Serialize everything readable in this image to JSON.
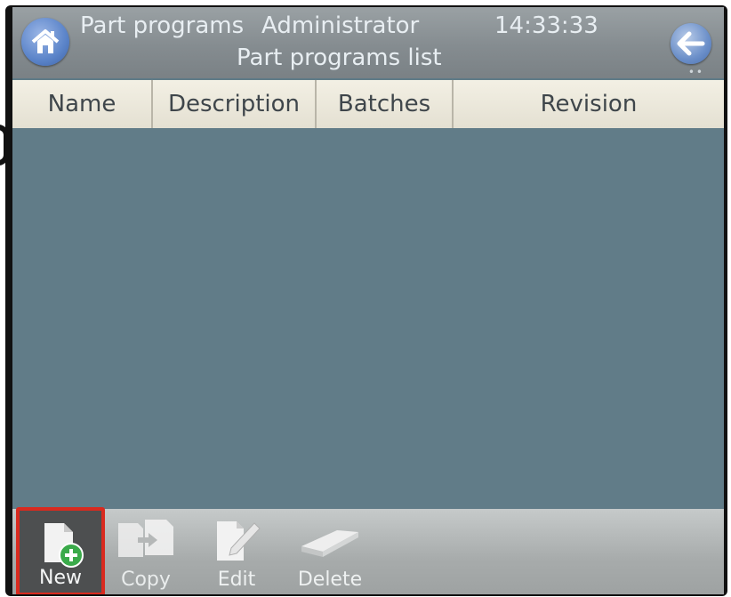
{
  "header": {
    "section_title": "Part programs",
    "user": "Administrator",
    "time": "14:33:33",
    "subtitle": "Part programs list",
    "home_icon": "home-icon",
    "back_icon": "arrow-left-icon"
  },
  "table": {
    "columns": [
      "Name",
      "Description",
      "Batches",
      "Revision"
    ],
    "rows": []
  },
  "toolbar": {
    "new_label": "New",
    "copy_label": "Copy",
    "edit_label": "Edit",
    "delete_label": "Delete"
  },
  "colors": {
    "highlight": "#d92a1f",
    "list_background": "#617c88",
    "new_icon_badge": "#3aaa4a"
  }
}
